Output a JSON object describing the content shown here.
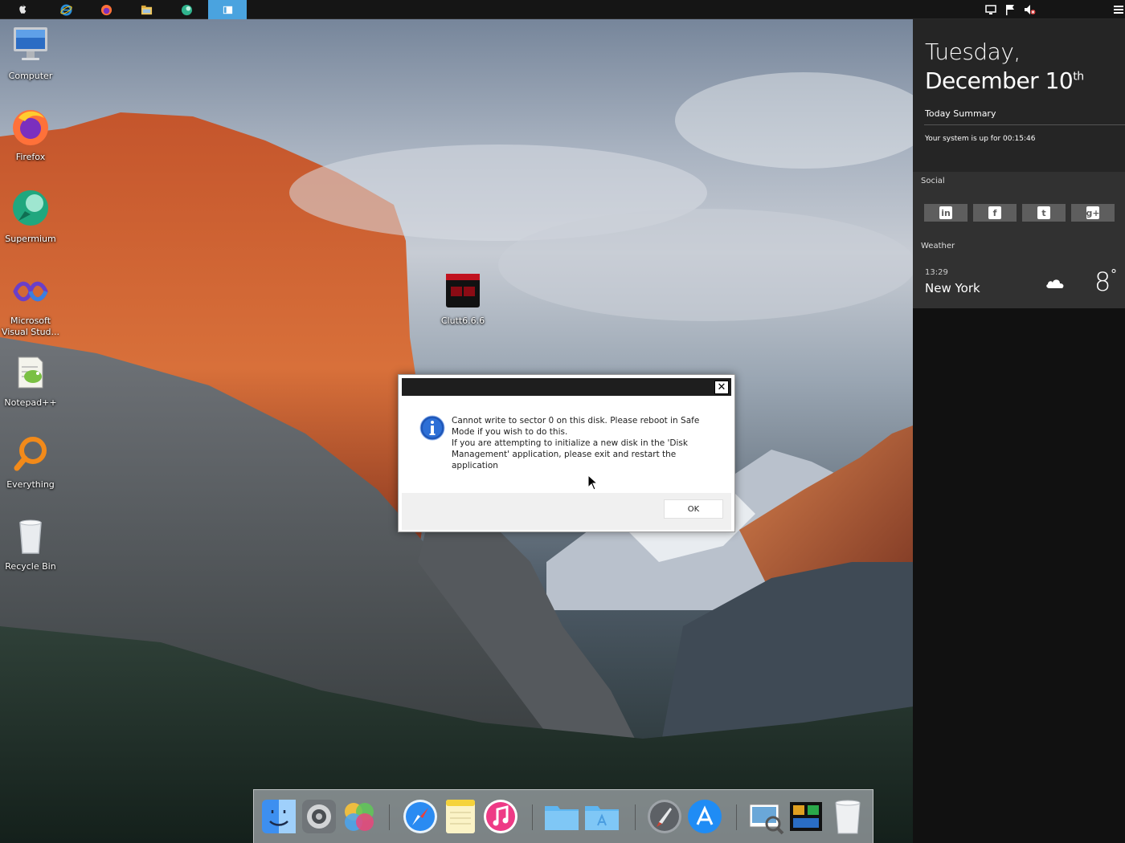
{
  "taskbar": {
    "buttons": [
      {
        "name": "start-icon"
      },
      {
        "name": "internet-explorer-icon"
      },
      {
        "name": "firefox-icon"
      },
      {
        "name": "file-explorer-icon"
      },
      {
        "name": "supermium-icon"
      },
      {
        "name": "active-window-icon",
        "active": true
      }
    ],
    "tray": [
      "network-icon",
      "flag-icon",
      "volume-muted-icon",
      "menu-icon"
    ]
  },
  "desktop": {
    "icons": [
      {
        "label": "Computer",
        "icon": "monitor-icon"
      },
      {
        "label": "Firefox",
        "icon": "firefox-icon"
      },
      {
        "label": "Supermium",
        "icon": "supermium-icon"
      },
      {
        "label": "Microsoft\nVisual Stud...",
        "icon": "visual-studio-icon"
      },
      {
        "label": "Notepad++",
        "icon": "notepad-plus-plus-icon"
      },
      {
        "label": "Everything",
        "icon": "magnifier-icon"
      },
      {
        "label": "Recycle Bin",
        "icon": "recycle-bin-icon"
      },
      {
        "label": "Clutt6.6.6",
        "icon": "clutt-app-icon"
      }
    ]
  },
  "panel": {
    "day": "Tuesday,",
    "date_main": "December 10",
    "date_suffix": "th",
    "summary_title": "Today Summary",
    "summary_text": "Your system is up for 00:15:46",
    "social_title": "Social",
    "social_buttons": [
      {
        "glyph": "in",
        "icon": "linkedin-icon"
      },
      {
        "glyph": "f",
        "icon": "facebook-icon"
      },
      {
        "glyph": "t",
        "icon": "twitter-icon"
      },
      {
        "glyph": "g+",
        "icon": "google-plus-icon"
      }
    ],
    "weather_title": "Weather",
    "weather_time": "13:29",
    "weather_city": "New York",
    "weather_temp": "8",
    "weather_deg": "°"
  },
  "dialog": {
    "title": "",
    "message": "Cannot write to sector 0 on this disk. Please reboot in Safe\nMode if you wish to do this.\nIf you are attempting to initialize a new disk in the 'Disk\nManagement' application, please exit and restart the\napplication",
    "ok_label": "OK",
    "close_glyph": "✕"
  },
  "dock": {
    "items": [
      "finder-icon",
      "system-preferences-icon",
      "photos-icon",
      "safari-icon",
      "notes-icon",
      "itunes-icon",
      "folder-icon",
      "applications-folder-icon",
      "launchpad-icon",
      "app-store-icon",
      "preview-icon",
      "activity-monitor-icon",
      "trash-icon"
    ]
  },
  "colors": {
    "accent": "#4aa3df",
    "panel_bg": "#252525",
    "social_bg": "#313131"
  }
}
